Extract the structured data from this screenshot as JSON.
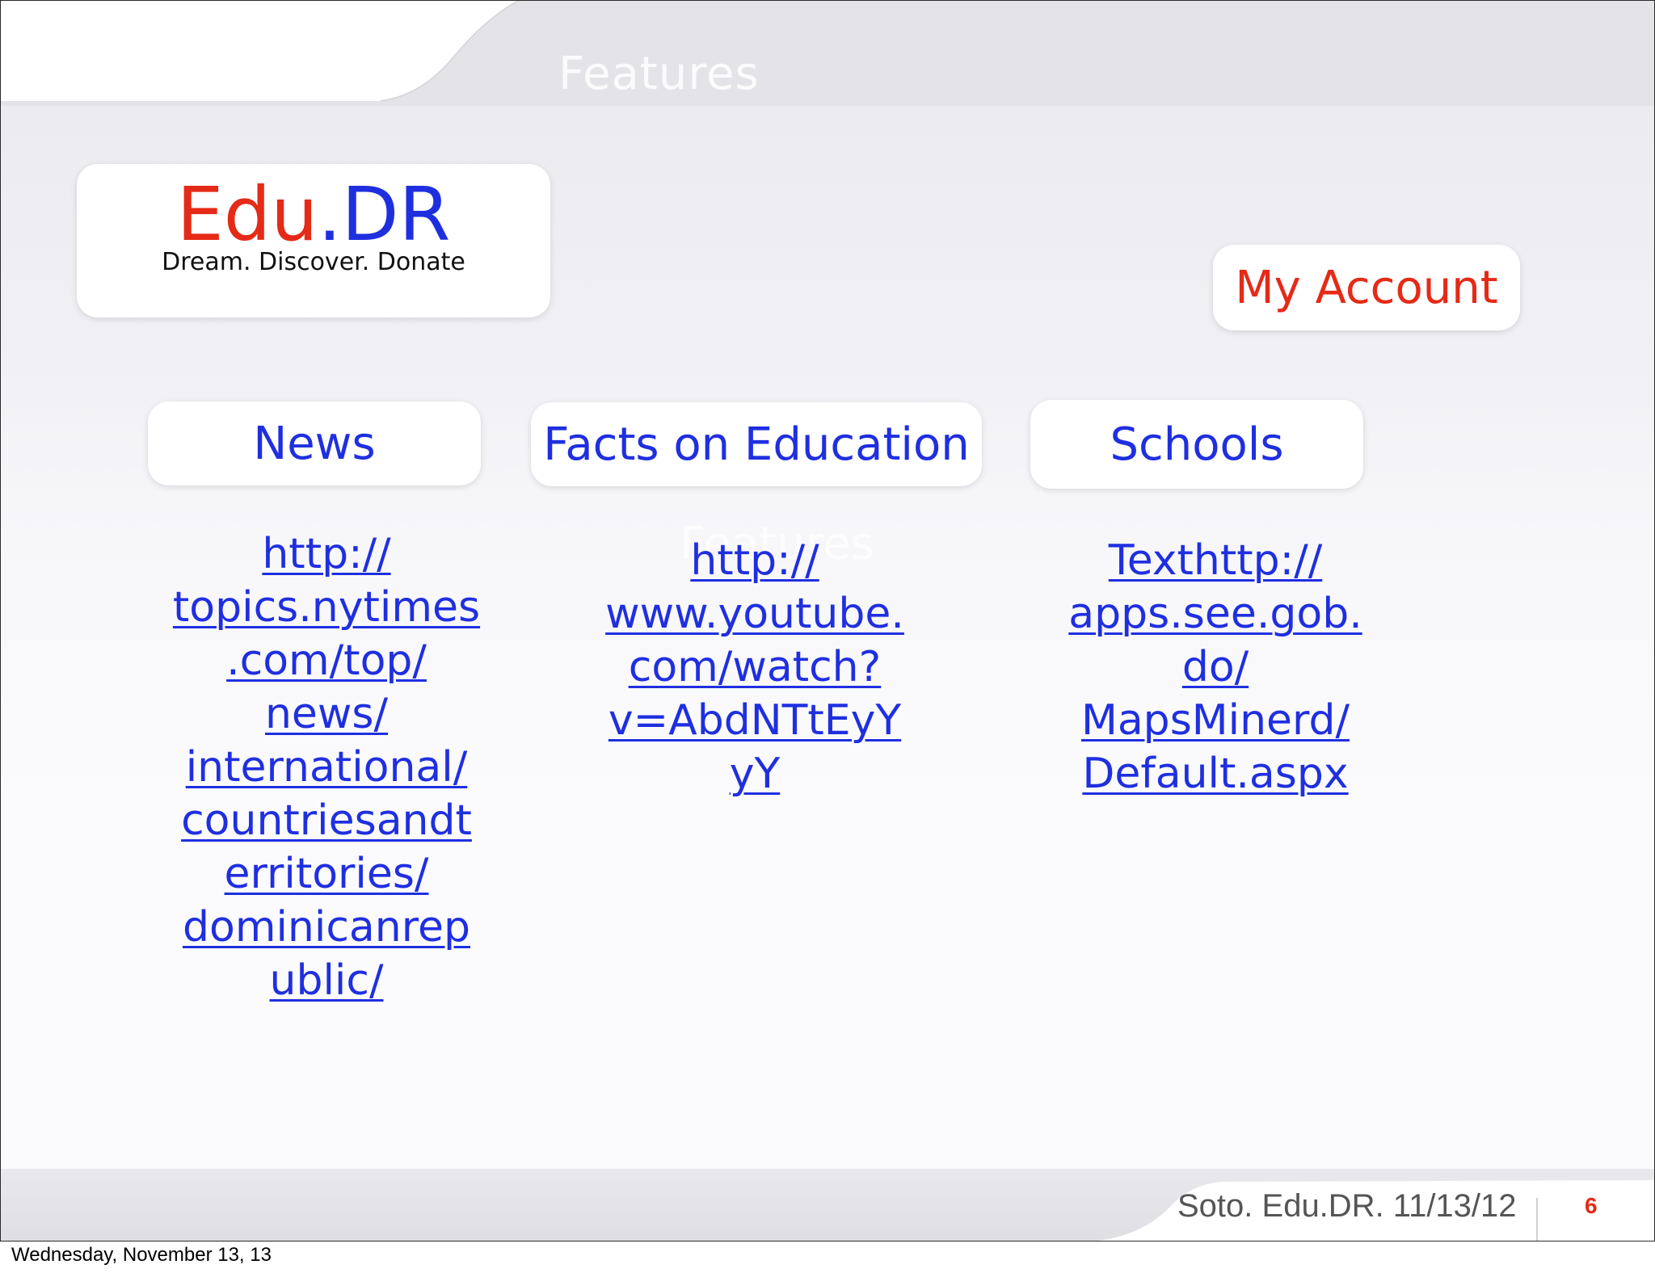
{
  "slide": {
    "title": "Features",
    "ghost_text": "Features"
  },
  "logo": {
    "part_red": "Edu",
    "part_blue": ".DR",
    "tagline": "Dream. Discover. Donate"
  },
  "account": {
    "label": "My Account"
  },
  "nav": [
    {
      "label": "News"
    },
    {
      "label": "Facts on Education"
    },
    {
      "label": "Schools"
    }
  ],
  "links": {
    "news": {
      "url": "http://topics.nytimes.com/top/news/international/countriesandterritories/dominicanrepublic/",
      "lines": [
        "http://",
        "topics.nytimes",
        ".com/top/",
        "news/",
        "international/",
        "countriesandt",
        "erritories/",
        "dominicanrep",
        "ublic/"
      ]
    },
    "facts": {
      "url": "http://www.youtube.com/watch?v=AbdNTtEyYyY",
      "lines": [
        "http://",
        "www.youtube.",
        "com/watch?",
        "v=AbdNTtEyY",
        "yY"
      ]
    },
    "schools": {
      "url": "http://apps.see.gob.do/MapsMinerd/Default.aspx",
      "lines": [
        "Texthttp://",
        "apps.see.gob.",
        "do/",
        "MapsMinerd/",
        "Default.aspx"
      ]
    }
  },
  "footer": {
    "credit": "Soto. Edu.DR. 11/13/12",
    "page_number": "6"
  },
  "capture_date": "Wednesday, November 13, 13",
  "colors": {
    "brand_red": "#e52a17",
    "brand_blue": "#1f2fe0"
  }
}
